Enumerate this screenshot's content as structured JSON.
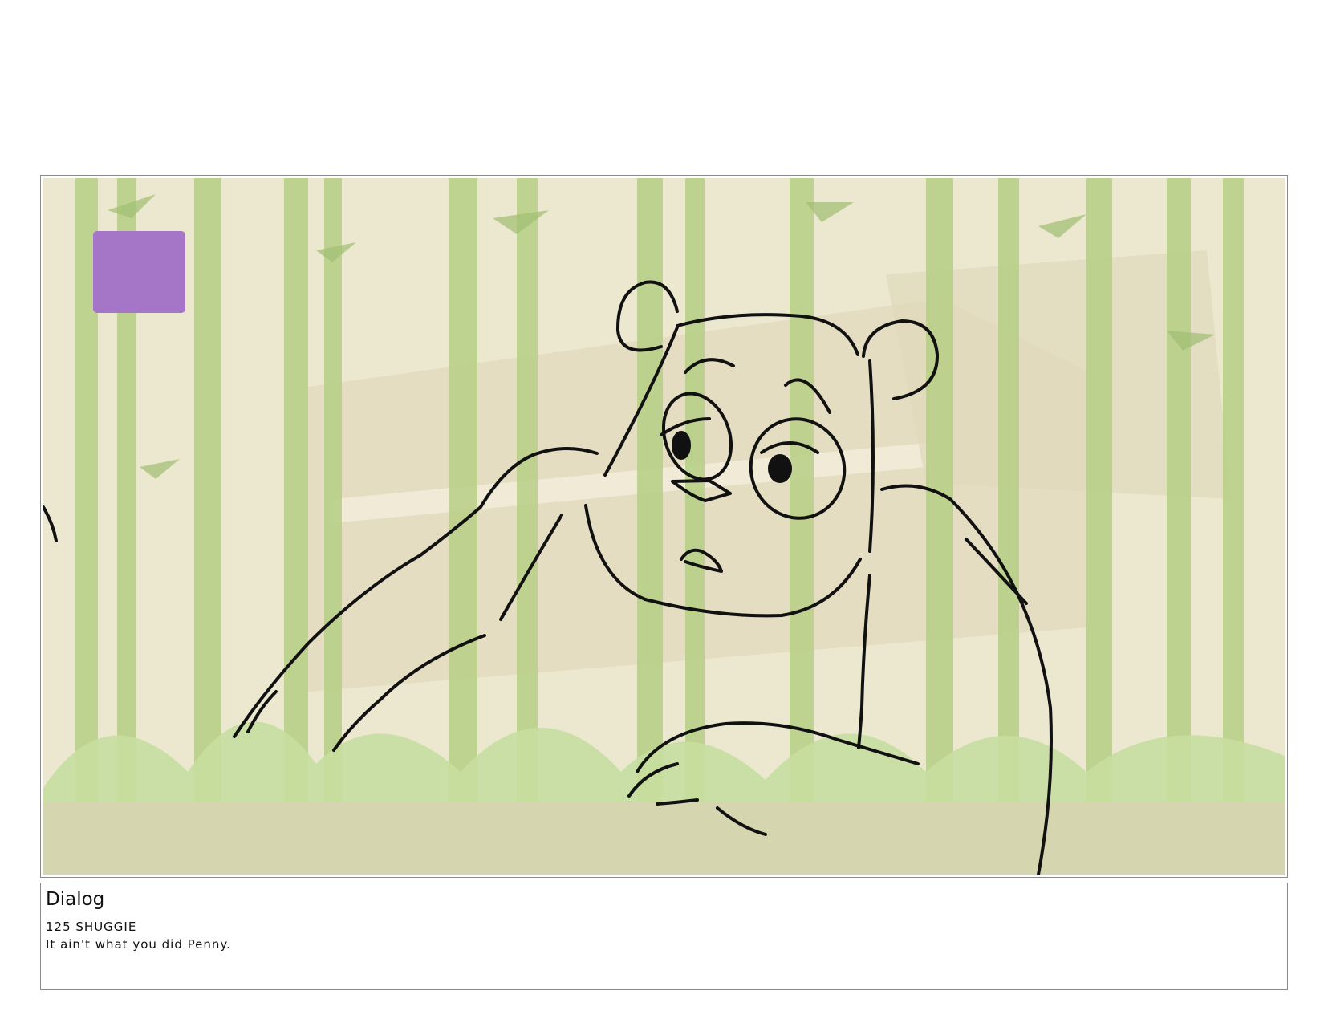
{
  "panel": {
    "marker_color": "#a575c8",
    "background_palette": {
      "sky": "#ece8cf",
      "bamboo": "#b7cf86",
      "bamboo_dark": "#9fbe72",
      "foliage": "#c7dea0",
      "ground": "#d7d3b1"
    },
    "line_color": "#111111",
    "icons": [
      "color-marker-square",
      "character-sketch",
      "bamboo-forest-background"
    ]
  },
  "dialog": {
    "heading": "Dialog",
    "lines": [
      "125 SHUGGIE",
      "It ain't what you did Penny."
    ]
  }
}
